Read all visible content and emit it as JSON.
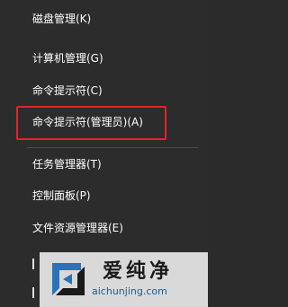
{
  "menu": {
    "items": [
      {
        "label": "磁盘管理(K)"
      },
      {
        "label": "计算机管理(G)"
      },
      {
        "label": "命令提示符(C)"
      },
      {
        "label": "命令提示符(管理员)(A)"
      },
      {
        "label": "任务管理器(T)"
      },
      {
        "label": "控制面板(P)"
      },
      {
        "label": "文件资源管理器(E)"
      }
    ],
    "highlight_color": "#e0242b"
  },
  "watermark": {
    "brand": "爱纯净",
    "url": "aichunjing.com"
  }
}
